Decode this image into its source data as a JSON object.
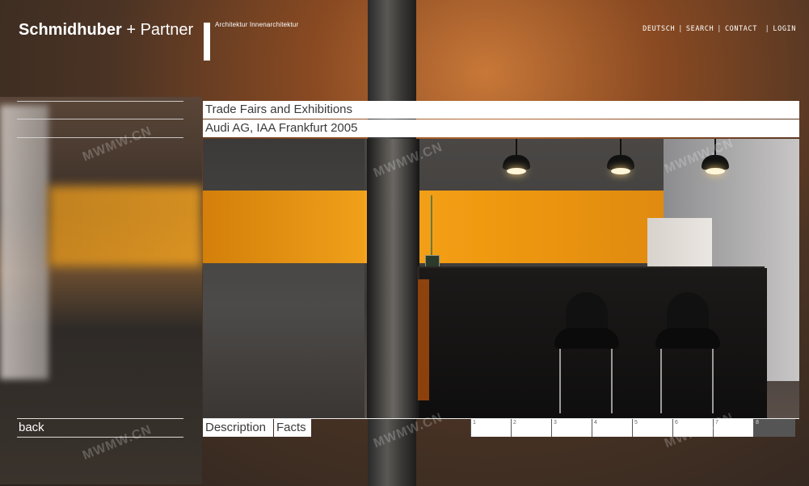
{
  "header": {
    "logo_bold": "Schmidhuber",
    "logo_rest": " + Partner",
    "tagline": "Architektur  Innenarchitektur"
  },
  "topnav": {
    "items": [
      "DEUTSCH",
      "SEARCH",
      "CONTACT",
      "LOGIN"
    ]
  },
  "content": {
    "category": "Trade Fairs and Exhibitions",
    "project": "Audi AG, IAA Frankfurt 2005"
  },
  "nav": {
    "back_label": "back",
    "tabs": [
      "Description",
      "Facts"
    ],
    "pages": [
      "1",
      "2",
      "3",
      "4",
      "5",
      "6",
      "7",
      "8"
    ],
    "active_page": "8"
  },
  "watermark": "MWMW.CN",
  "colors": {
    "accent_orange": "#f09a10",
    "active_page": "#555555"
  }
}
